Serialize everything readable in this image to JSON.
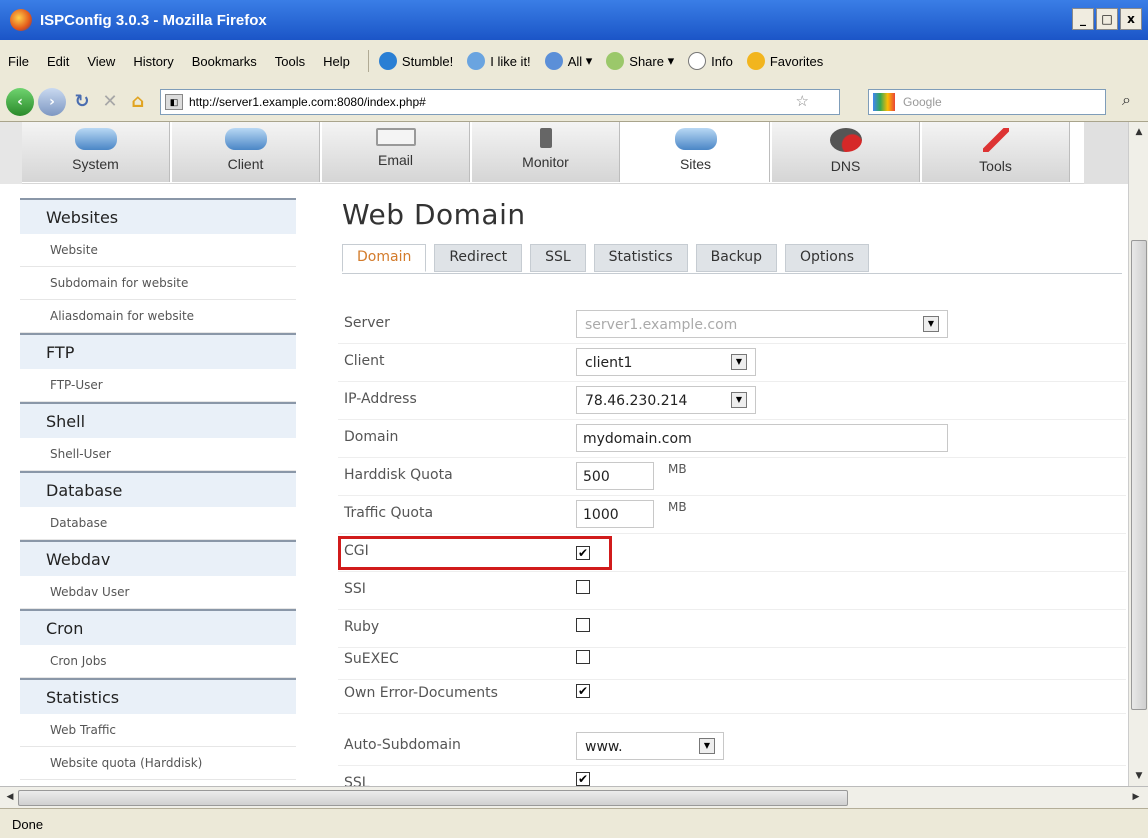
{
  "window": {
    "title": "ISPConfig 3.0.3 - Mozilla Firefox",
    "buttons": [
      "_",
      "□",
      "x"
    ]
  },
  "menu": {
    "items": [
      "File",
      "Edit",
      "View",
      "History",
      "Bookmarks",
      "Tools",
      "Help"
    ],
    "toolbar": [
      "Stumble!",
      "I like it!",
      "All",
      "Share",
      "Info",
      "Favorites"
    ]
  },
  "nav": {
    "url": "http://server1.example.com:8080/index.php#",
    "search_placeholder": "Google"
  },
  "modules": [
    {
      "label": "System"
    },
    {
      "label": "Client"
    },
    {
      "label": "Email"
    },
    {
      "label": "Monitor"
    },
    {
      "label": "Sites"
    },
    {
      "label": "DNS"
    },
    {
      "label": "Tools"
    }
  ],
  "sidebar": [
    {
      "head": "Websites",
      "items": [
        "Website",
        "Subdomain for website",
        "Aliasdomain for website"
      ]
    },
    {
      "head": "FTP",
      "items": [
        "FTP-User"
      ]
    },
    {
      "head": "Shell",
      "items": [
        "Shell-User"
      ]
    },
    {
      "head": "Database",
      "items": [
        "Database"
      ]
    },
    {
      "head": "Webdav",
      "items": [
        "Webdav User"
      ]
    },
    {
      "head": "Cron",
      "items": [
        "Cron Jobs"
      ]
    },
    {
      "head": "Statistics",
      "items": [
        "Web Traffic",
        "Website quota (Harddisk)"
      ]
    }
  ],
  "main": {
    "title": "Web Domain",
    "tabs": [
      "Domain",
      "Redirect",
      "SSL",
      "Statistics",
      "Backup",
      "Options"
    ],
    "fields": {
      "server": {
        "label": "Server",
        "value": "server1.example.com"
      },
      "client": {
        "label": "Client",
        "value": "client1"
      },
      "ip": {
        "label": "IP-Address",
        "value": "78.46.230.214"
      },
      "domain": {
        "label": "Domain",
        "value": "mydomain.com"
      },
      "hdquota": {
        "label": "Harddisk Quota",
        "value": "500",
        "unit": "MB"
      },
      "trquota": {
        "label": "Traffic Quota",
        "value": "1000",
        "unit": "MB"
      },
      "cgi": {
        "label": "CGI",
        "checked": "✔"
      },
      "ssi": {
        "label": "SSI",
        "checked": ""
      },
      "ruby": {
        "label": "Ruby",
        "checked": ""
      },
      "suexec": {
        "label": "SuEXEC",
        "checked": ""
      },
      "errdocs": {
        "label": "Own Error-Documents",
        "checked": "✔"
      },
      "autosub": {
        "label": "Auto-Subdomain",
        "value": "www."
      },
      "ssl": {
        "label": "SSL",
        "checked": "✔"
      }
    }
  },
  "status": "Done"
}
